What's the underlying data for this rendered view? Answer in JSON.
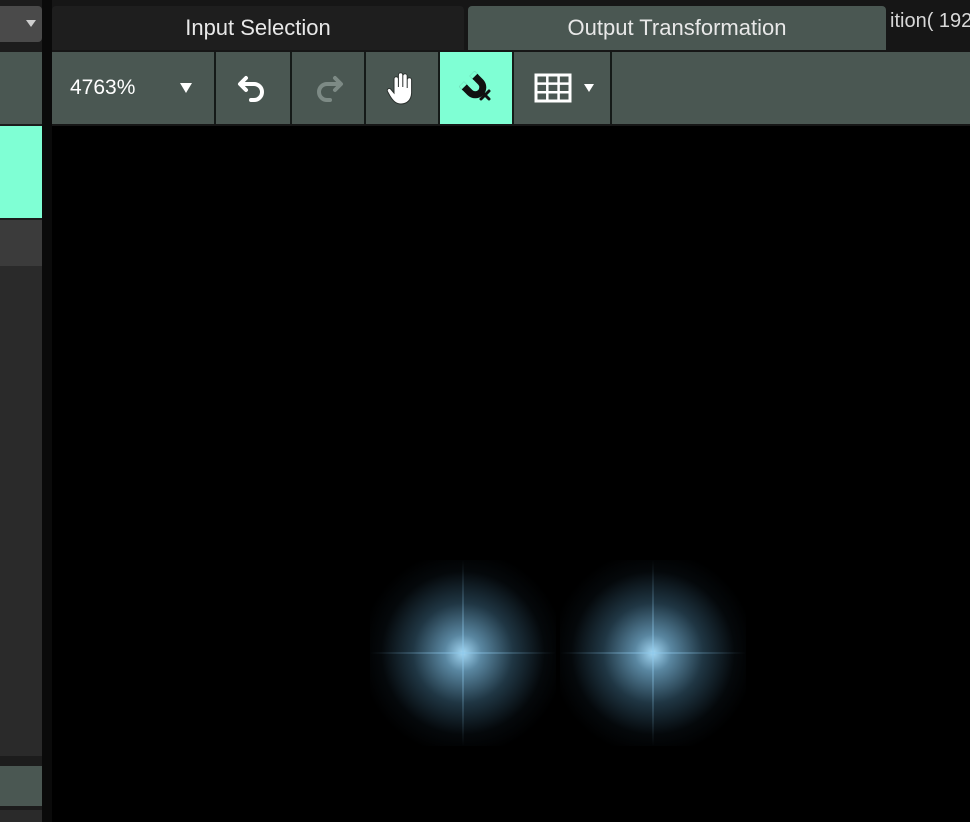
{
  "tabs": {
    "input_selection": "Input Selection",
    "output_transformation": "Output Transformation",
    "partial_title": "ition( 192"
  },
  "toolbar": {
    "zoom_value": "4763%",
    "icons": {
      "undo": "undo-icon",
      "redo": "redo-icon",
      "hand": "hand-pan-icon",
      "snap": "magnet-snap-icon",
      "grid": "grid-icon"
    },
    "snap_active": true
  },
  "colors": {
    "accent": "#7fffd4",
    "toolbar_bg": "#4a5752",
    "canvas_bg": "#000000",
    "glow": "#aae1ff"
  }
}
